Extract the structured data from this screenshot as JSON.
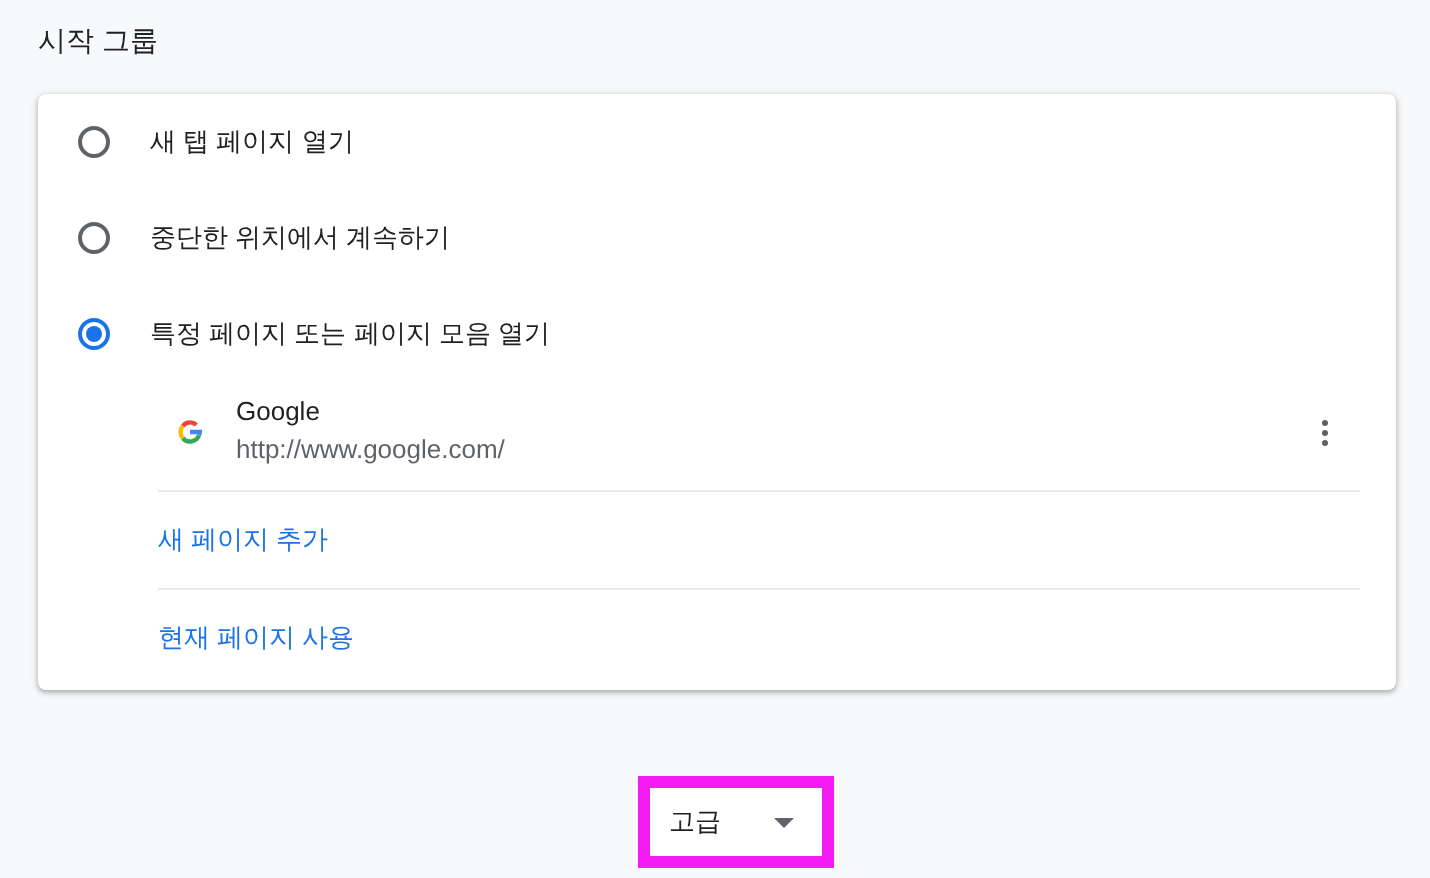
{
  "section_title": "시작 그룹",
  "options": [
    {
      "label": "새 탭 페이지 열기",
      "selected": false
    },
    {
      "label": "중단한 위치에서 계속하기",
      "selected": false
    },
    {
      "label": "특정 페이지 또는 페이지 모음 열기",
      "selected": true
    }
  ],
  "pages": [
    {
      "title": "Google",
      "url": "http://www.google.com/"
    }
  ],
  "links": [
    "새 페이지 추가",
    "현재 페이지 사용"
  ],
  "advanced_button": {
    "label": "고급",
    "highlighted": true
  }
}
